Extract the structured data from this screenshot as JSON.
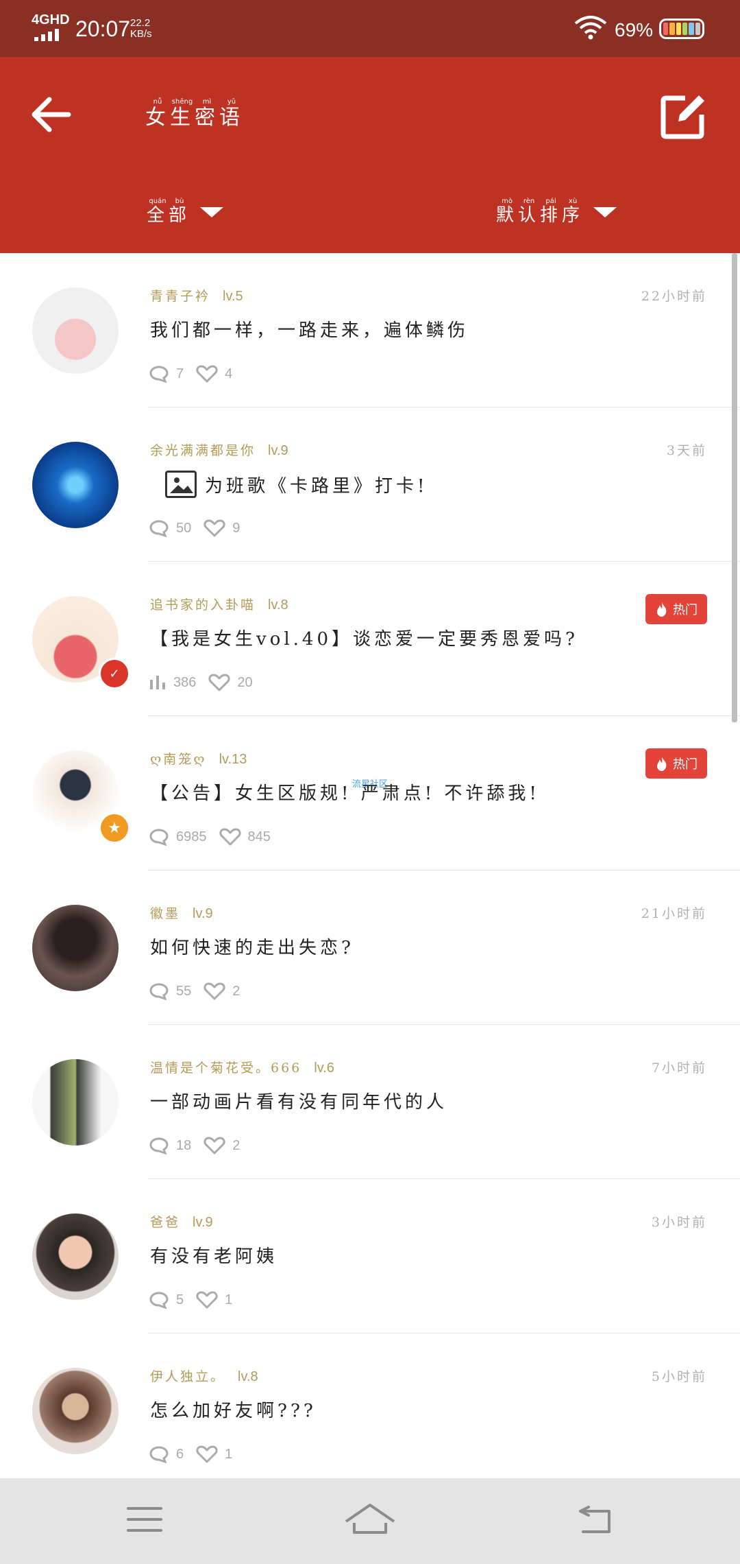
{
  "status_bar": {
    "network": "4GHD",
    "time": "20:07",
    "speed_value": "22.2",
    "speed_unit": "KB/s",
    "battery_pct": "69%"
  },
  "header": {
    "title": "女生密语",
    "title_pinyin": [
      "nǚ",
      "shēng",
      "mì",
      "yǔ"
    ],
    "filter_label": "全部",
    "filter_pinyin": [
      "quán",
      "bù"
    ],
    "sort_label": "默认排序",
    "sort_pinyin": [
      "mò",
      "rèn",
      "pái",
      "xù"
    ]
  },
  "hot_label": "热门",
  "posts": [
    {
      "username": "青青子衿",
      "level": "lv.5",
      "time": "22小时前",
      "text": "我们都一样，一路走来，遍体鳞伤",
      "comments": "7",
      "likes": "4",
      "comment_icon": "comment-icon",
      "hot": false,
      "has_image": false
    },
    {
      "username": "余光满满都是你",
      "level": "lv.9",
      "time": "3天前",
      "text": "为班歌《卡路里》打卡!",
      "comments": "50",
      "likes": "9",
      "comment_icon": "comment-icon",
      "hot": false,
      "has_image": true
    },
    {
      "username": "追书家的入卦喵",
      "level": "lv.8",
      "time": "",
      "text": "【我是女生vol.40】谈恋爱一定要秀恩爱吗?",
      "comments": "386",
      "likes": "20",
      "comment_icon": "poll-icon",
      "hot": true,
      "has_image": false
    },
    {
      "username": "ღ南笼ღ",
      "level": "lv.13",
      "time": "",
      "text": "【公告】女生区版规! 严肃点! 不许舔我!",
      "comments": "6985",
      "likes": "845",
      "comment_icon": "comment-icon",
      "hot": true,
      "has_image": false
    },
    {
      "username": "徽墨",
      "level": "lv.9",
      "time": "21小时前",
      "text": "如何快速的走出失恋?",
      "comments": "55",
      "likes": "2",
      "comment_icon": "comment-icon",
      "hot": false,
      "has_image": false
    },
    {
      "username": "温情是个菊花受。666",
      "level": "lv.6",
      "time": "7小时前",
      "text": "一部动画片看有没有同年代的人",
      "comments": "18",
      "likes": "2",
      "comment_icon": "comment-icon",
      "hot": false,
      "has_image": false
    },
    {
      "username": "爸爸",
      "level": "lv.9",
      "time": "3小时前",
      "text": "有没有老阿姨",
      "comments": "5",
      "likes": "1",
      "comment_icon": "comment-icon",
      "hot": false,
      "has_image": false
    },
    {
      "username": "伊人独立。",
      "level": "lv.8",
      "time": "5小时前",
      "text": "怎么加好友啊???",
      "comments": "6",
      "likes": "1",
      "comment_icon": "comment-icon",
      "hot": false,
      "has_image": false
    }
  ],
  "watermark": "流星社区",
  "colors": {
    "status_bar": "#8a2f23",
    "header": "#be3223",
    "accent_gold": "#b59a58",
    "hot": "#e2443a"
  }
}
